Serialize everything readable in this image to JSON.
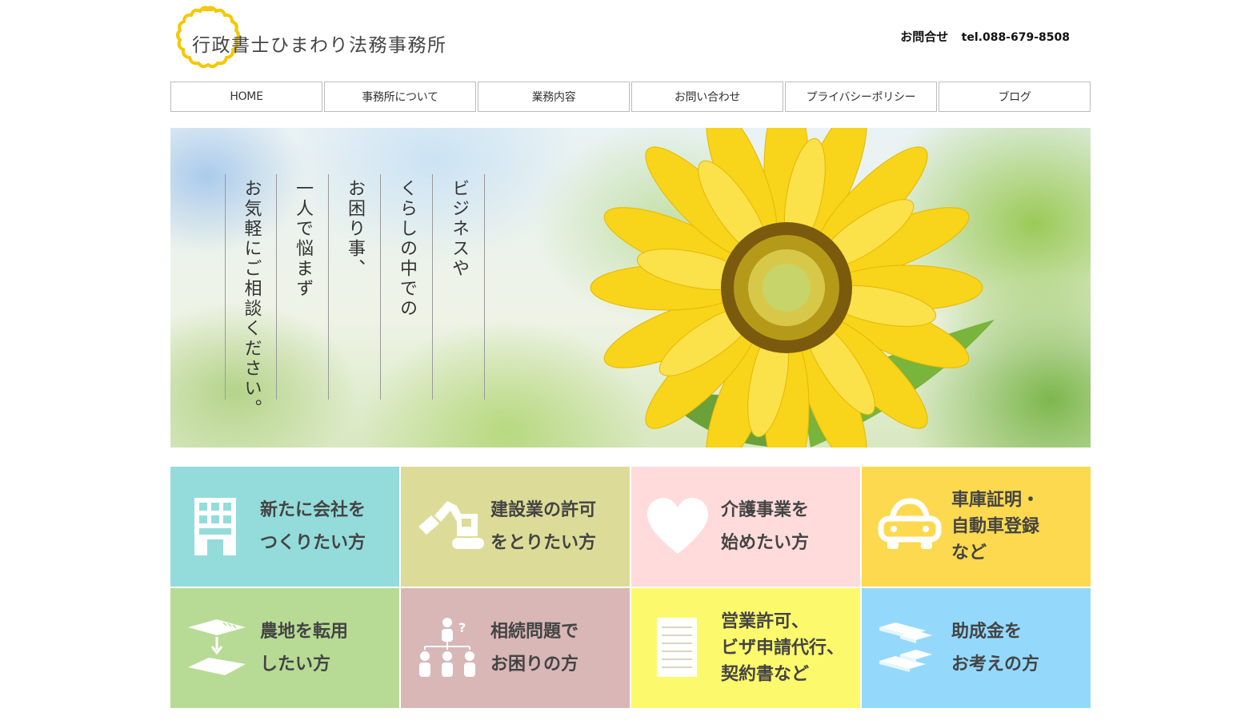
{
  "header": {
    "logo_text": "行政書士ひまわり法務事務所",
    "contact_label": "お問合せ",
    "phone": "tel.088-679-8508"
  },
  "nav": {
    "items": [
      {
        "label": "HOME"
      },
      {
        "label": "事務所について"
      },
      {
        "label": "業務内容"
      },
      {
        "label": "お問い合わせ"
      },
      {
        "label": "プライバシーポリシー"
      },
      {
        "label": "ブログ"
      }
    ]
  },
  "hero": {
    "lines": [
      "ビジネスや",
      "くらしの中での",
      "お困り事、",
      "一人で悩まず",
      "お気軽にご相談ください。"
    ]
  },
  "tiles": [
    {
      "text": "新たに会社を\nつくりたい方",
      "icon": "building-icon",
      "color": "#94dcdb"
    },
    {
      "text": "建設業の許可\nをとりたい方",
      "icon": "excavator-icon",
      "color": "#dcdc98"
    },
    {
      "text": "介護事業を\n始めたい方",
      "icon": "heart-icon",
      "color": "#ffdbdb"
    },
    {
      "text": "車庫証明・\n自動車登録\nなど",
      "icon": "car-icon",
      "color": "#fcd94e"
    },
    {
      "text": "農地を転用\nしたい方",
      "icon": "land-conversion-icon",
      "color": "#b7db94"
    },
    {
      "text": "相続問題で\nお困りの方",
      "icon": "family-tree-icon",
      "color": "#d9b7b7"
    },
    {
      "text": "営業許可、\nビザ申請代行、\n契約書など",
      "icon": "document-icon",
      "color": "#fcfa6c"
    },
    {
      "text": "助成金を\nお考えの方",
      "icon": "money-stack-icon",
      "color": "#94d9fc"
    }
  ],
  "colors": {
    "accent_yellow": "#fcd94e",
    "nav_border": "#bcbcbc"
  }
}
